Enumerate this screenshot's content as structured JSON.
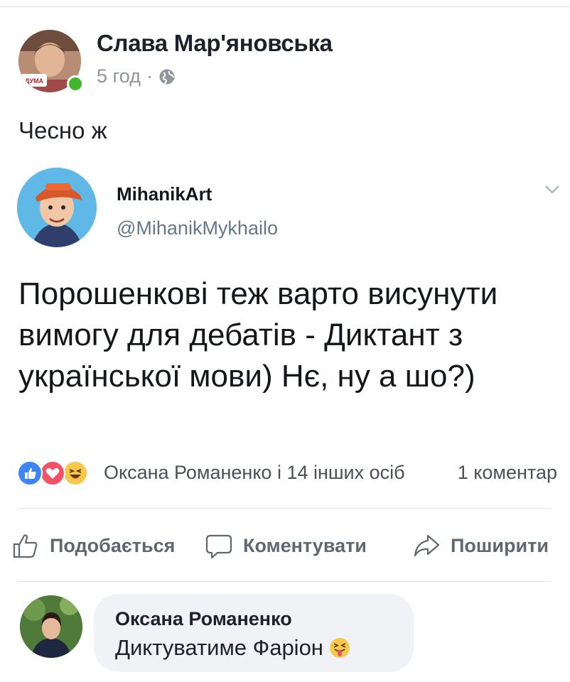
{
  "post": {
    "author": "Слава Мар'яновська",
    "avatar_badge": "ДУМА",
    "time": "5 год",
    "separator": "·",
    "privacy_icon": "globe-icon",
    "text": "Чесно ж"
  },
  "tweet": {
    "name": "MihanikArt",
    "handle": "@MihanikMykhailo",
    "body": "Порошенкові теж варто висунути вимогу для дебатів - Диктант з української мови) Нє, ну а шо?)"
  },
  "reactions": {
    "icons": [
      "like-reaction-icon",
      "love-reaction-icon",
      "haha-reaction-icon"
    ],
    "names": "Оксана Романенко і 14 інших осіб",
    "comments": "1 коментар"
  },
  "actions": {
    "like": "Подобається",
    "comment": "Коментувати",
    "share": "Поширити"
  },
  "comment": {
    "author": "Оксана Романенко",
    "text": "Диктуватиме Фаріон",
    "emoji": "tongue-emoji-icon"
  },
  "colors": {
    "online": "#42b72a",
    "like": "#3b85f5",
    "love": "#f25268",
    "haha": "#f7c84c",
    "secondary_text": "#90949c",
    "bubble": "#f1f2f6"
  }
}
